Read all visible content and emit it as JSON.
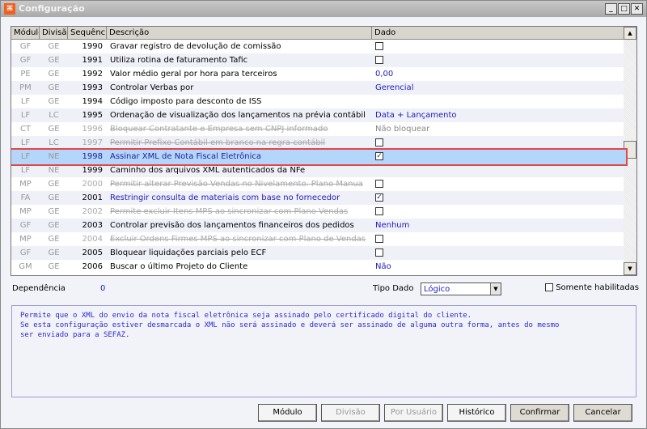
{
  "window": {
    "title": "Configuração",
    "minimize": "_",
    "maximize": "□",
    "close": "✕"
  },
  "columns": [
    "Módulo",
    "Divisão",
    "Sequência",
    "Descrição",
    "Dado"
  ],
  "rows": [
    {
      "modulo": "GF",
      "divisao": "GE",
      "seq": "1990",
      "desc": "Gravar registro de devolução de comissão",
      "dado": "",
      "dado_type": "checkbox",
      "checked": false,
      "state": "normal"
    },
    {
      "modulo": "GF",
      "divisao": "GE",
      "seq": "1991",
      "desc": "Utiliza rotina de faturamento Tafic",
      "dado": "",
      "dado_type": "checkbox",
      "checked": false,
      "state": "normal"
    },
    {
      "modulo": "PE",
      "divisao": "GE",
      "seq": "1992",
      "desc": "Valor médio geral por hora para terceiros",
      "dado": "0,00",
      "dado_type": "text",
      "state": "normal"
    },
    {
      "modulo": "PM",
      "divisao": "GE",
      "seq": "1993",
      "desc": "Controlar Verbas por",
      "dado": "Gerencial",
      "dado_type": "text",
      "state": "normal"
    },
    {
      "modulo": "LF",
      "divisao": "GE",
      "seq": "1994",
      "desc": "Código imposto para desconto de ISS",
      "dado": "",
      "dado_type": "text",
      "state": "normal"
    },
    {
      "modulo": "LF",
      "divisao": "LC",
      "seq": "1995",
      "desc": "Ordenação de visualização dos lançamentos na prévia contábil",
      "dado": "Data + Lançamento",
      "dado_type": "text",
      "state": "normal"
    },
    {
      "modulo": "CT",
      "divisao": "GE",
      "seq": "1996",
      "desc": "Bloquear Contratante e Empresa sem CNPJ informado",
      "dado": "Não bloquear",
      "dado_type": "text",
      "state": "disabled"
    },
    {
      "modulo": "LF",
      "divisao": "LC",
      "seq": "1997",
      "desc": "Permitir Prefixo Contábil em branco na regra contábil",
      "dado": "",
      "dado_type": "checkbox",
      "checked": false,
      "state": "disabled"
    },
    {
      "modulo": "LF",
      "divisao": "NE",
      "seq": "1998",
      "desc": "Assinar XML de Nota Fiscal Eletrônica",
      "dado": "",
      "dado_type": "checkbox",
      "checked": true,
      "state": "selected"
    },
    {
      "modulo": "LF",
      "divisao": "NE",
      "seq": "1999",
      "desc": "Caminho dos arquivos XML autenticados da NFe",
      "dado": "",
      "dado_type": "text",
      "state": "normal"
    },
    {
      "modulo": "MP",
      "divisao": "GE",
      "seq": "2000",
      "desc": "Permitir alterar Previsão Vendas no Nivelamento. Plano Manua",
      "dado": "",
      "dado_type": "checkbox",
      "checked": false,
      "state": "disabled"
    },
    {
      "modulo": "FA",
      "divisao": "GE",
      "seq": "2001",
      "desc": "Restringir consulta de materiais com base no fornecedor",
      "dado": "",
      "dado_type": "checkbox",
      "checked": true,
      "state": "blue"
    },
    {
      "modulo": "MP",
      "divisao": "GE",
      "seq": "2002",
      "desc": "Permite excluir Itens MPS ao sincronizar com Plano Vendas",
      "dado": "",
      "dado_type": "checkbox",
      "checked": false,
      "state": "disabled"
    },
    {
      "modulo": "GF",
      "divisao": "GE",
      "seq": "2003",
      "desc": "Controlar previsão dos lançamentos financeiros dos pedidos",
      "dado": "Nenhum",
      "dado_type": "text",
      "state": "normal"
    },
    {
      "modulo": "MP",
      "divisao": "GE",
      "seq": "2004",
      "desc": "Excluir Ordens Firmes MPS ao sincronizar com Plano de Vendas",
      "dado": "",
      "dado_type": "checkbox",
      "checked": false,
      "state": "disabled"
    },
    {
      "modulo": "GF",
      "divisao": "GE",
      "seq": "2005",
      "desc": "Bloquear liquidações parciais pelo ECF",
      "dado": "",
      "dado_type": "checkbox",
      "checked": false,
      "state": "normal"
    },
    {
      "modulo": "GM",
      "divisao": "GE",
      "seq": "2006",
      "desc": "Buscar o último Projeto do Cliente",
      "dado": "Não",
      "dado_type": "text",
      "state": "normal"
    }
  ],
  "footer": {
    "dependencia_label": "Dependência",
    "dependencia_value": "0",
    "tipo_dado_label": "Tipo Dado",
    "tipo_dado_value": "Lógico",
    "somente_label": "Somente habilitadas",
    "somente_checked": false
  },
  "description": [
    "Permite que o XML do envio da nota fiscal eletrônica seja assinado pelo certificado digital do cliente.",
    "Se esta configuração estiver desmarcada o XML não será assinado e deverá ser assinado de alguma outra forma, antes do mesmo",
    "ser enviado para a SEFAZ."
  ],
  "buttons": {
    "modulo": "Módulo",
    "divisao": "Divisão",
    "por_usuario": "Por Usuário",
    "historico": "Histórico",
    "confirmar": "Confirmar",
    "cancelar": "Cancelar"
  }
}
